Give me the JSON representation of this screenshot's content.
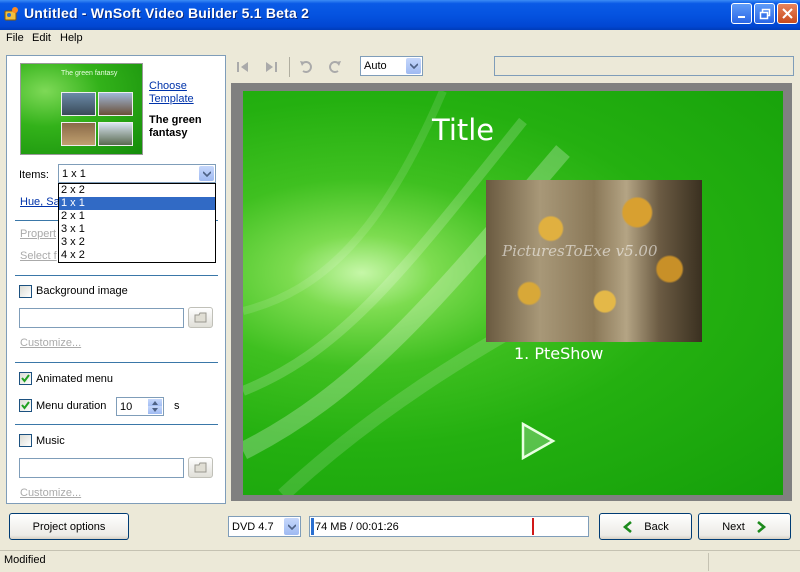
{
  "window": {
    "title": "Untitled - WnSoft Video Builder 5.1 Beta 2"
  },
  "menu": [
    "File",
    "Edit",
    "Help"
  ],
  "template": {
    "thumb_title": "The green fantasy",
    "choose_link": "Choose Template",
    "name": "The green fantasy"
  },
  "items": {
    "label": "Items:",
    "value": "1 x 1",
    "options": [
      "2 x 2",
      "1 x 1",
      "2 x 1",
      "3 x 1",
      "3 x 2",
      "4 x 2"
    ],
    "selected_index": 1
  },
  "links": {
    "hue": "Hue, Sa",
    "properties": "Propert",
    "select": "Select f"
  },
  "background": {
    "label": "Background image",
    "checked": false,
    "path": "",
    "customize": "Customize..."
  },
  "animated_menu": {
    "label": "Animated menu",
    "checked": true
  },
  "menu_duration": {
    "label": "Menu duration",
    "checked": true,
    "value": "10",
    "unit": "s"
  },
  "music": {
    "label": "Music",
    "checked": false,
    "path": "",
    "customize": "Customize..."
  },
  "toolbar": {
    "zoom": "Auto"
  },
  "preview": {
    "title": "Title",
    "watermark": "PicturesToExe v5.00",
    "caption": "1. PteShow"
  },
  "bottom": {
    "project_options": "Project options",
    "disc_type": "DVD 4.7",
    "size_text": "74 MB / 00:01:26",
    "size_used_fraction": 0.01,
    "size_limit_fraction": 0.8,
    "back": "Back",
    "next": "Next"
  },
  "status": {
    "text": "Modified"
  },
  "colors": {
    "accent": "#316ac5",
    "link": "#0033aa",
    "titlebar": "#0553e0"
  }
}
